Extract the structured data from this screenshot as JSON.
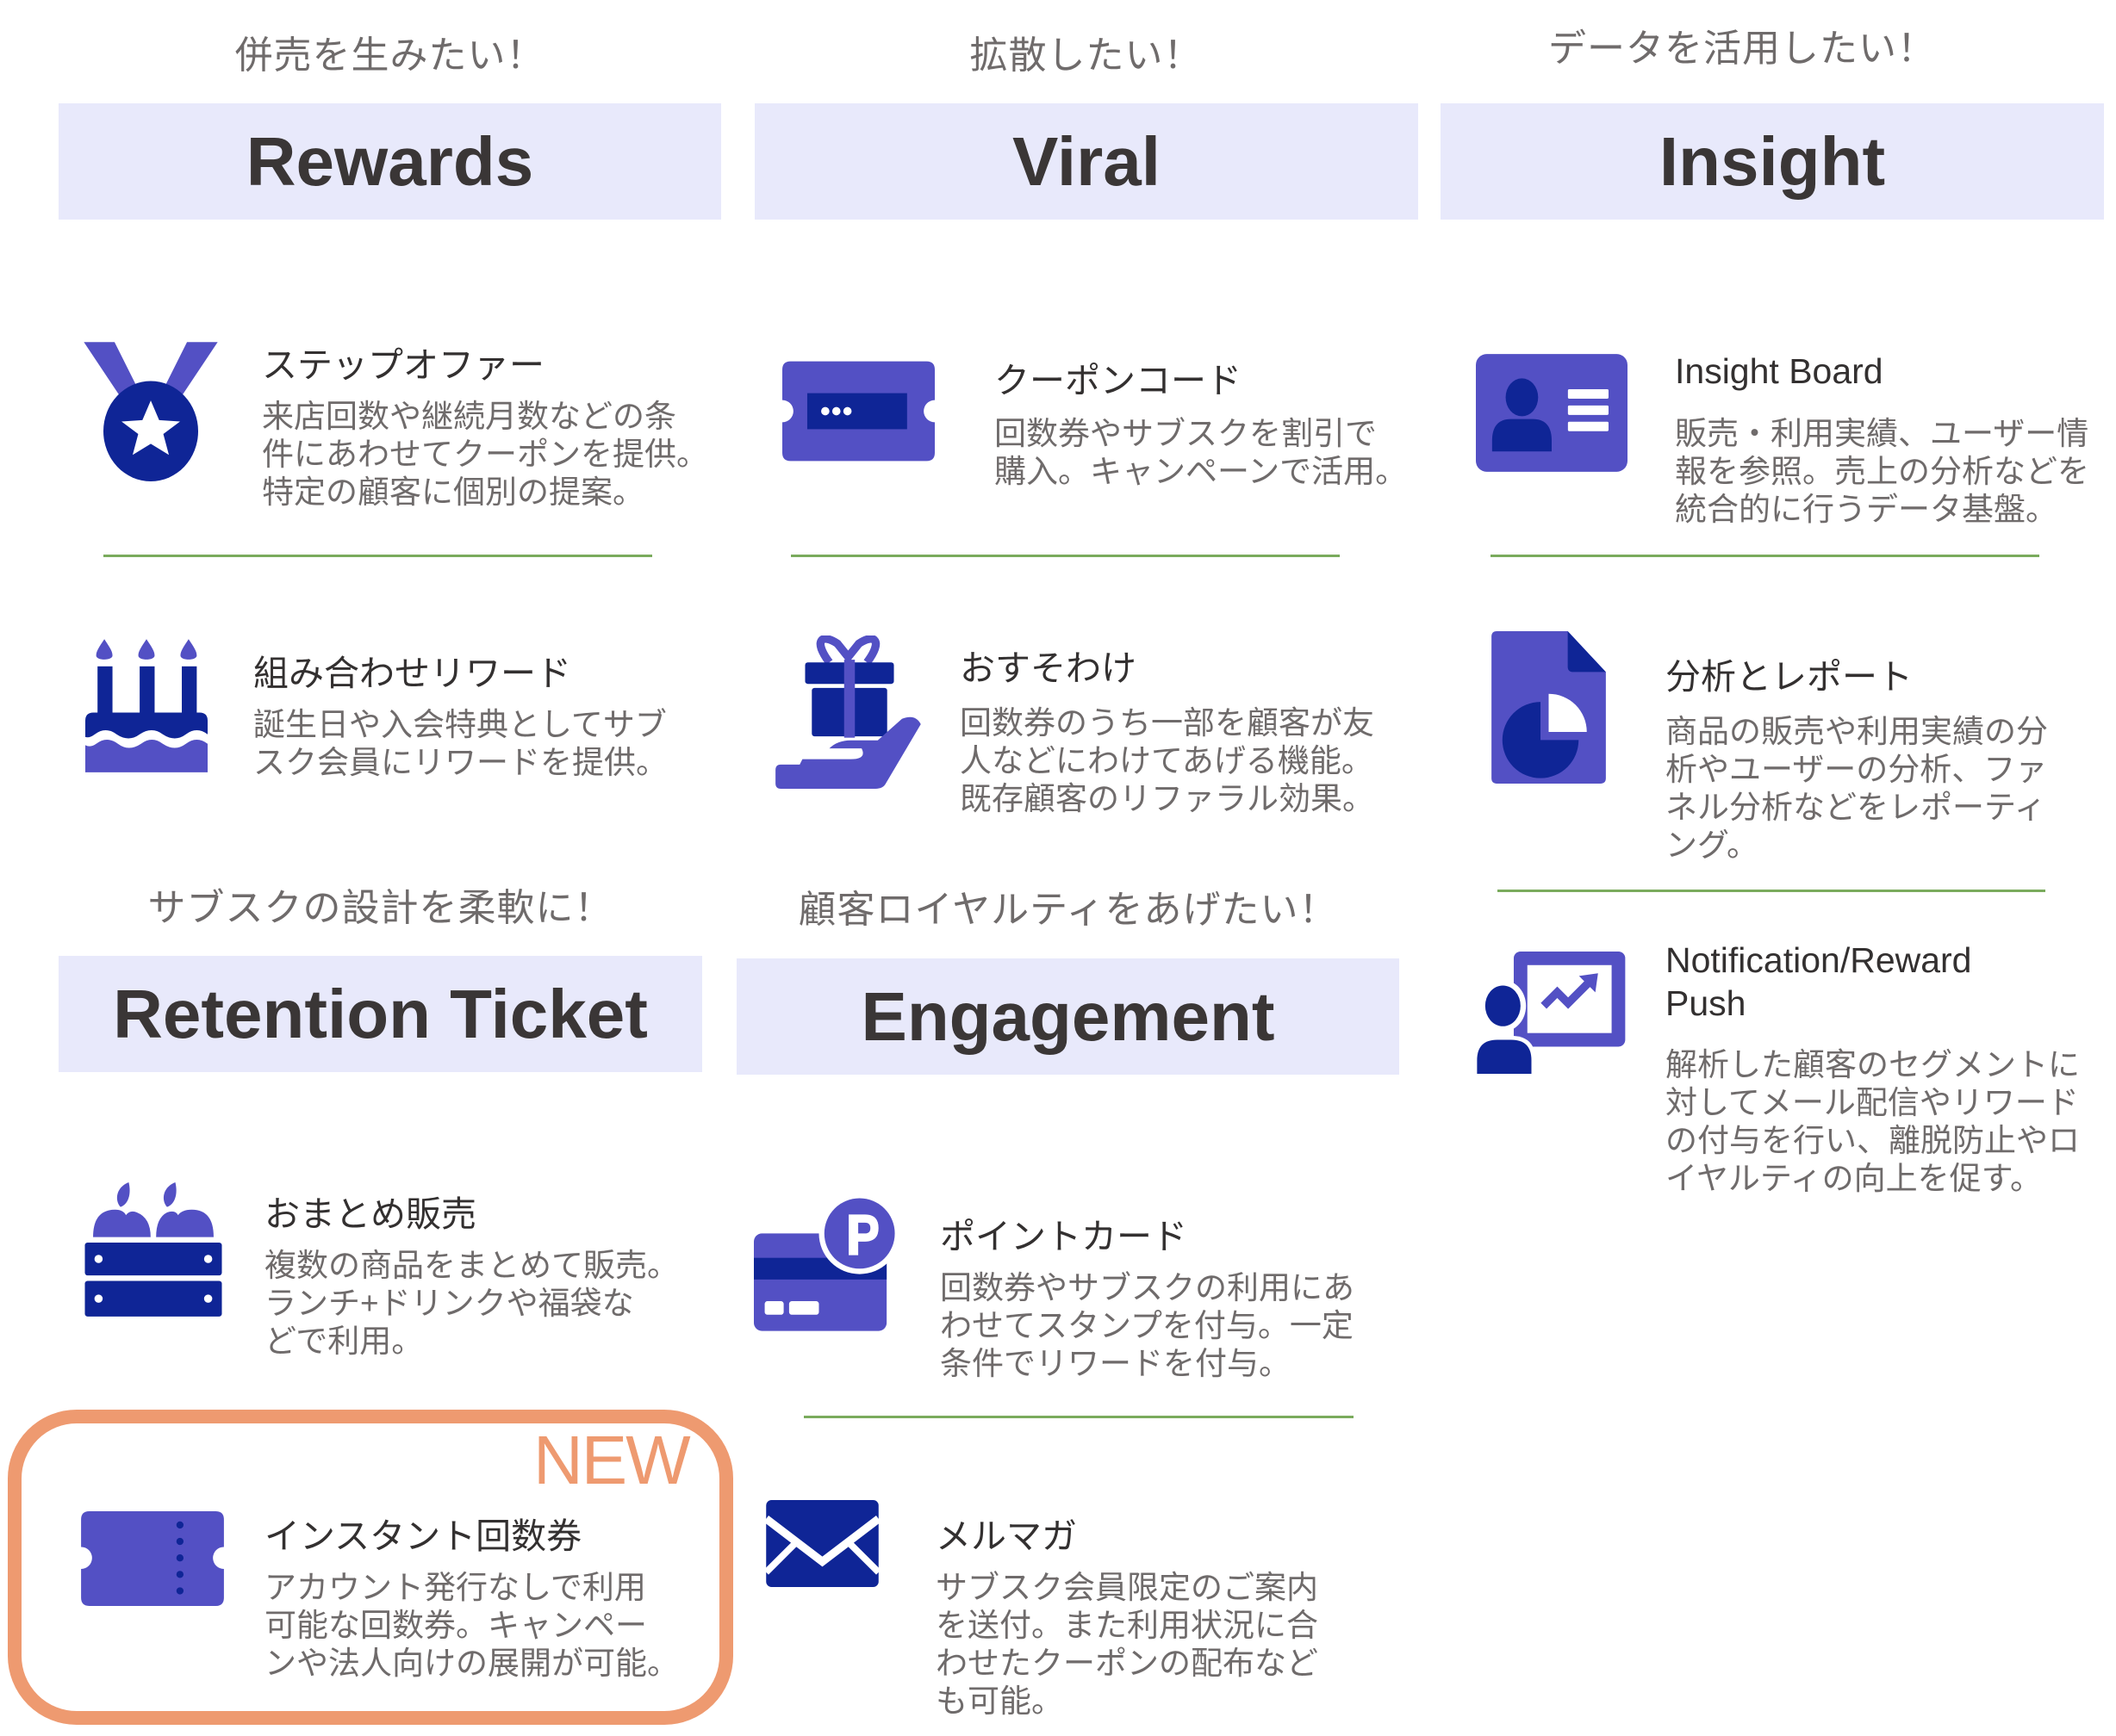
{
  "colors": {
    "primary": "#5350c4",
    "navy": "#0f2596",
    "band": "#e8e9fb",
    "divider": "#7aab5d",
    "new_accent": "#ee9a70"
  },
  "sections": {
    "rewards": {
      "caption": "併売を生みたい！",
      "title": "Rewards",
      "items": [
        {
          "icon": "medal-icon",
          "title": "ステップオファー",
          "desc": "来店回数や継続月数などの条\n件にあわせてクーポンを提供。\n特定の顧客に個別の提案。"
        },
        {
          "icon": "birthday-cake-icon",
          "title": "組み合わせリワード",
          "desc": "誕生日や入会特典としてサブ\nスク会員にリワードを提供。"
        }
      ]
    },
    "viral": {
      "caption": "拡散したい！",
      "title": "Viral",
      "items": [
        {
          "icon": "coupon-ticket-icon",
          "title": "クーポンコード",
          "desc": "回数券やサブスクを割引で\n購入。キャンペーンで活用。"
        },
        {
          "icon": "gift-hand-icon",
          "title": "おすそわけ",
          "desc": "回数券のうち一部を顧客が友\n人などにわけてあげる機能。\n既存顧客のリファラル効果。"
        }
      ]
    },
    "insight": {
      "caption": "データを活用したい！",
      "title": "Insight",
      "items": [
        {
          "icon": "profile-card-icon",
          "title": "Insight Board",
          "desc": "販売・利用実績、ユーザー情\n報を参照。売上の分析などを\n統合的に行うデータ基盤。"
        },
        {
          "icon": "pie-chart-document-icon",
          "title": "分析とレポート",
          "desc": "商品の販売や利用実績の分\n析やユーザーの分析、ファ\nネル分析などをレポーティ\nング。"
        },
        {
          "icon": "presentation-user-icon",
          "title": "Notification/Reward\nPush",
          "title_line1": "Notification/Reward",
          "title_line2": "Push",
          "desc": "解析した顧客のセグメントに\n対してメール配信やリワード\nの付与を行い、離脱防止やロ\nイヤルティの向上を促す。"
        }
      ]
    },
    "retention": {
      "caption": "サブスクの設計を柔軟に！",
      "title": "Retention Ticket",
      "items": [
        {
          "icon": "fruit-crate-icon",
          "title": "おまとめ販売",
          "desc": "複数の商品をまとめて販売。\nランチ+ドリンクや福袋な\nどで利用。"
        },
        {
          "icon": "instant-ticket-icon",
          "title": "インスタント回数券",
          "desc": "アカウント発行なしで利用\n可能な回数券。キャンペー\nンや法人向けの展開が可能。",
          "badge": "NEW"
        }
      ]
    },
    "engagement": {
      "caption": "顧客ロイヤルティをあげたい！",
      "title": "Engagement",
      "items": [
        {
          "icon": "point-card-icon",
          "title": "ポイントカード",
          "desc": "回数券やサブスクの利用にあ\nわせてスタンプを付与。一定\n条件でリワードを付与。"
        },
        {
          "icon": "mail-envelope-icon",
          "title": "メルマガ",
          "desc": "サブスク会員限定のご案内\nを送付。また利用状況に合\nわせたクーポンの配布など\nも可能。"
        }
      ]
    }
  }
}
